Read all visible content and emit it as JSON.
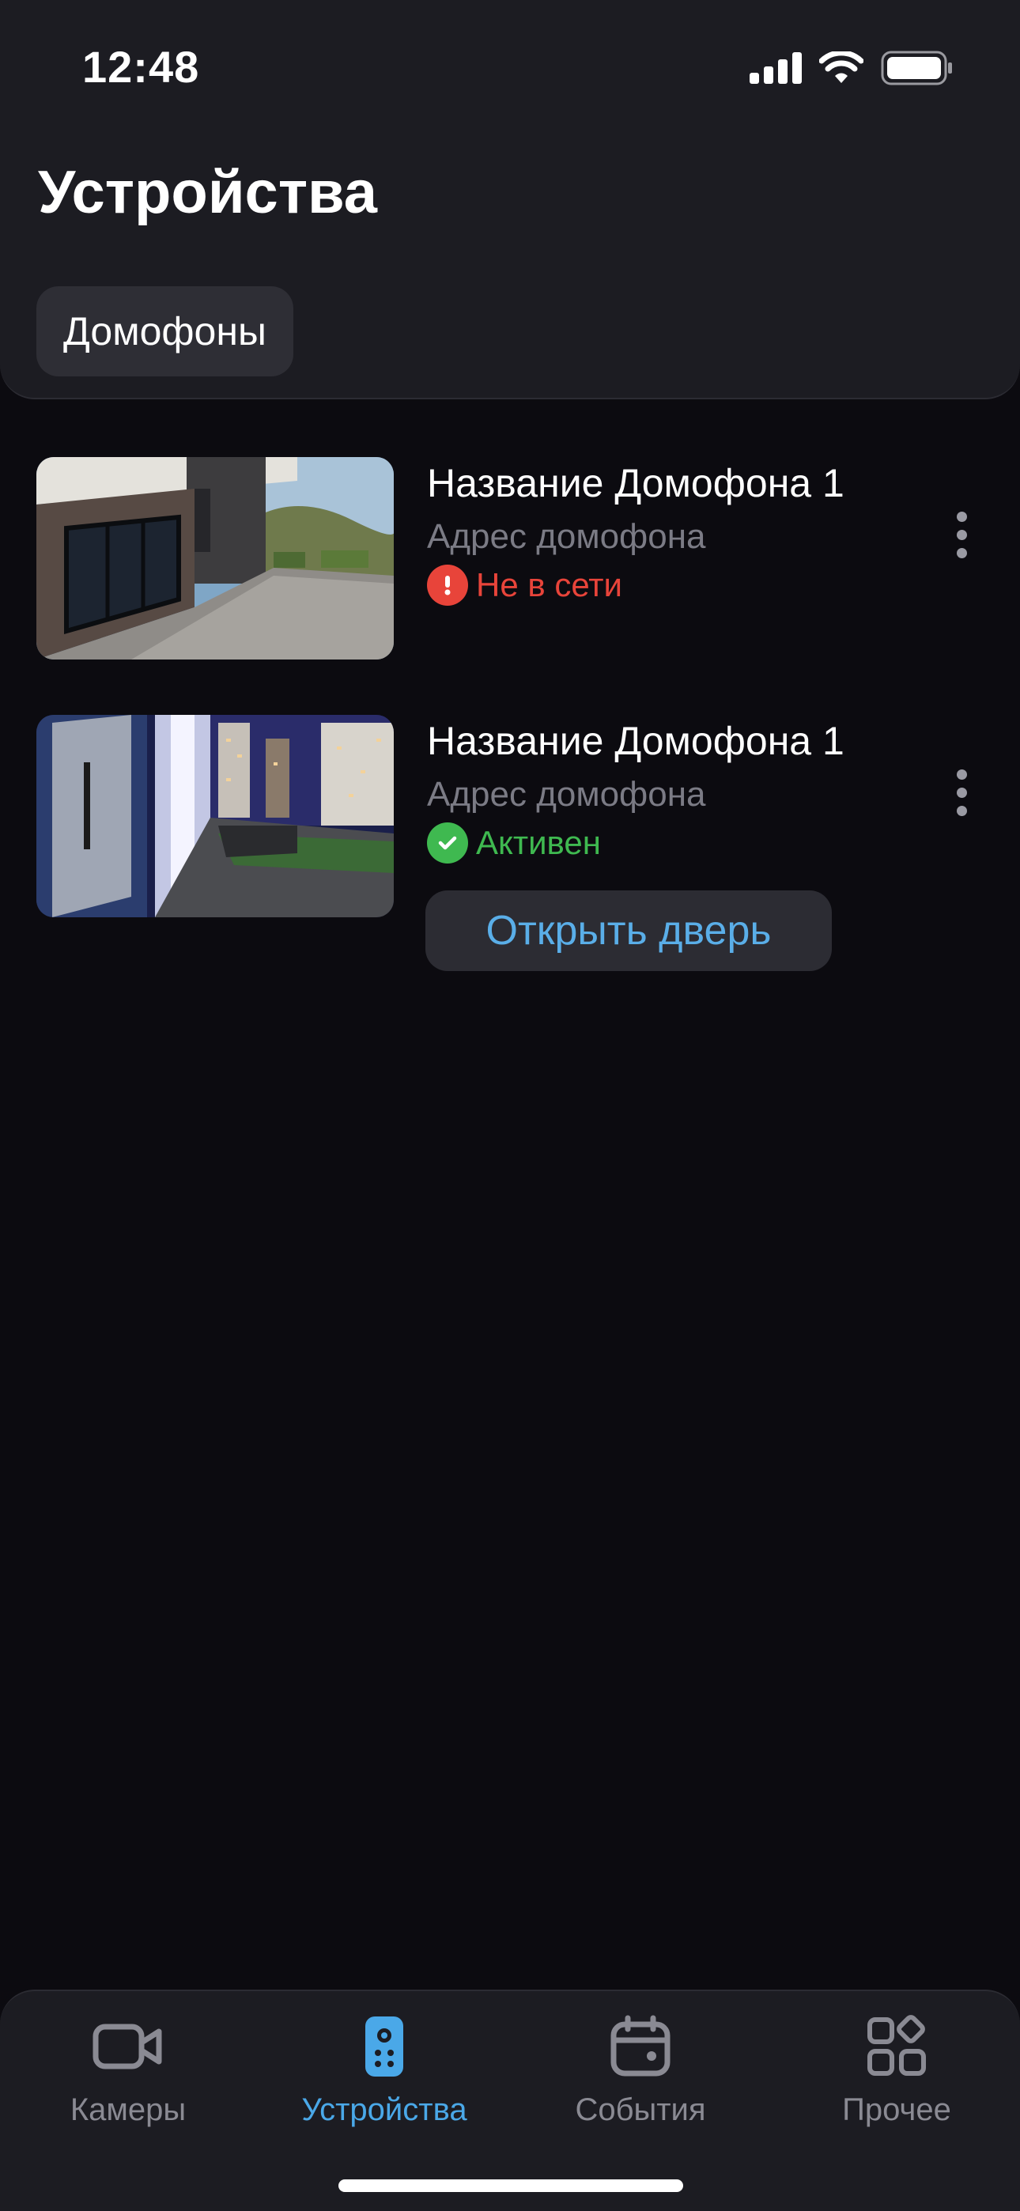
{
  "status_bar": {
    "time": "12:48"
  },
  "header": {
    "title": "Устройства",
    "filter_chip": "Домофоны"
  },
  "devices": [
    {
      "name": "Название Домофона 1",
      "address": "Адрес домофона",
      "status": "Не в сети",
      "status_color": "#e8443a",
      "status_icon": "alert-icon"
    },
    {
      "name": "Название Домофона 1",
      "address": "Адрес домофона",
      "status": "Активен",
      "status_color": "#3fb950",
      "status_icon": "check-icon",
      "action_label": "Открыть дверь"
    }
  ],
  "tabbar": {
    "tabs": [
      {
        "label": "Камеры",
        "icon": "video-camera-icon",
        "active": false
      },
      {
        "label": "Устройства",
        "icon": "remote-control-icon",
        "active": true
      },
      {
        "label": "События",
        "icon": "calendar-icon",
        "active": false
      },
      {
        "label": "Прочее",
        "icon": "grid-icon",
        "active": false
      }
    ]
  },
  "colors": {
    "accent": "#4aa8e8",
    "background": "#0c0b10",
    "surface": "#1c1c22"
  }
}
